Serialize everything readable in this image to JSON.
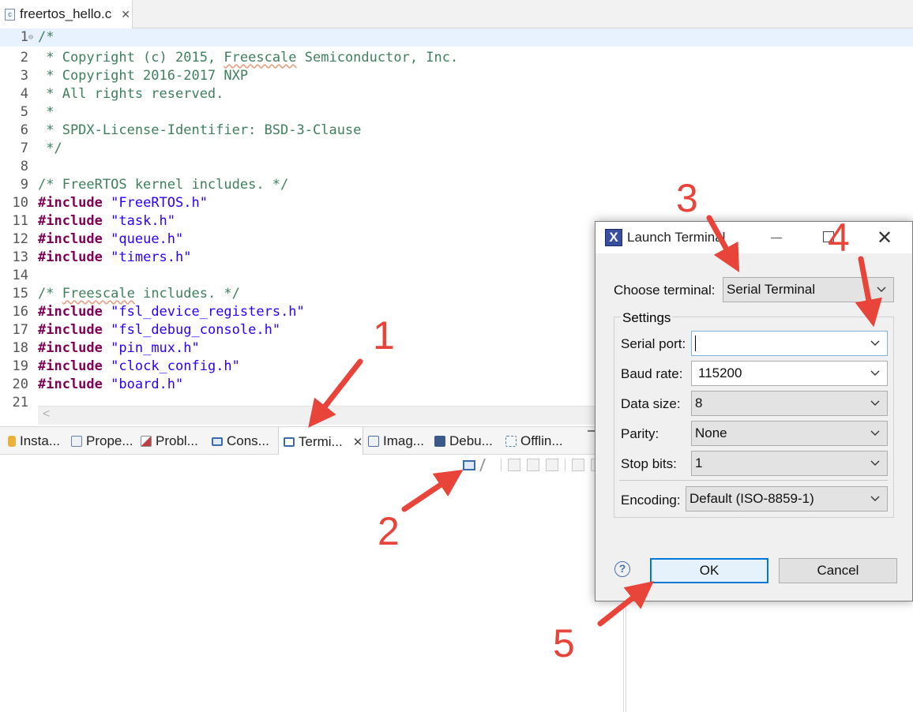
{
  "editor": {
    "tab_label": "freertos_hello.c",
    "close_symbol": "✕",
    "scroll_left_symbol": "<",
    "lines": [
      {
        "no": "1",
        "segments": [
          {
            "t": "/*",
            "c": "comment"
          }
        ]
      },
      {
        "no": "2",
        "segments": [
          {
            "t": " * Copyright (c) 2015, ",
            "c": "comment"
          },
          {
            "t": "Freescale",
            "c": "comment-sq"
          },
          {
            "t": " Semiconductor, Inc.",
            "c": "comment"
          }
        ]
      },
      {
        "no": "3",
        "segments": [
          {
            "t": " * Copyright 2016-2017 NXP",
            "c": "comment"
          }
        ]
      },
      {
        "no": "4",
        "segments": [
          {
            "t": " * All rights reserved.",
            "c": "comment"
          }
        ]
      },
      {
        "no": "5",
        "segments": [
          {
            "t": " *",
            "c": "comment"
          }
        ]
      },
      {
        "no": "6",
        "segments": [
          {
            "t": " * SPDX-License-Identifier: BSD-3-Clause",
            "c": "comment"
          }
        ]
      },
      {
        "no": "7",
        "segments": [
          {
            "t": " */",
            "c": "comment"
          }
        ]
      },
      {
        "no": "8",
        "segments": []
      },
      {
        "no": "9",
        "segments": [
          {
            "t": "/* FreeRTOS kernel includes. */",
            "c": "comment"
          }
        ]
      },
      {
        "no": "10",
        "segments": [
          {
            "t": "#include",
            "c": "kw"
          },
          {
            "t": " ",
            "c": ""
          },
          {
            "t": "\"FreeRTOS.h\"",
            "c": "str"
          }
        ]
      },
      {
        "no": "11",
        "segments": [
          {
            "t": "#include",
            "c": "kw"
          },
          {
            "t": " ",
            "c": ""
          },
          {
            "t": "\"task.h\"",
            "c": "str"
          }
        ]
      },
      {
        "no": "12",
        "segments": [
          {
            "t": "#include",
            "c": "kw"
          },
          {
            "t": " ",
            "c": ""
          },
          {
            "t": "\"queue.h\"",
            "c": "str"
          }
        ]
      },
      {
        "no": "13",
        "segments": [
          {
            "t": "#include",
            "c": "kw"
          },
          {
            "t": " ",
            "c": ""
          },
          {
            "t": "\"timers.h\"",
            "c": "str"
          }
        ]
      },
      {
        "no": "14",
        "segments": []
      },
      {
        "no": "15",
        "segments": [
          {
            "t": "/* ",
            "c": "comment"
          },
          {
            "t": "Freescale",
            "c": "comment-sq"
          },
          {
            "t": " includes. */",
            "c": "comment"
          }
        ]
      },
      {
        "no": "16",
        "segments": [
          {
            "t": "#include",
            "c": "kw"
          },
          {
            "t": " ",
            "c": ""
          },
          {
            "t": "\"fsl_device_registers.h\"",
            "c": "str"
          }
        ]
      },
      {
        "no": "17",
        "segments": [
          {
            "t": "#include",
            "c": "kw"
          },
          {
            "t": " ",
            "c": ""
          },
          {
            "t": "\"fsl_debug_console.h\"",
            "c": "str"
          }
        ]
      },
      {
        "no": "18",
        "segments": [
          {
            "t": "#include",
            "c": "kw"
          },
          {
            "t": " ",
            "c": ""
          },
          {
            "t": "\"pin_mux.h\"",
            "c": "str"
          }
        ]
      },
      {
        "no": "19",
        "segments": [
          {
            "t": "#include",
            "c": "kw"
          },
          {
            "t": " ",
            "c": ""
          },
          {
            "t": "\"clock_config.h\"",
            "c": "str"
          }
        ]
      },
      {
        "no": "20",
        "segments": [
          {
            "t": "#include",
            "c": "kw"
          },
          {
            "t": " ",
            "c": ""
          },
          {
            "t": "\"board.h\"",
            "c": "str"
          }
        ]
      },
      {
        "no": "21",
        "segments": []
      }
    ]
  },
  "views": {
    "tabs": [
      {
        "label": "Insta...",
        "icon": "cylinder-icon",
        "color": "#e8b33a"
      },
      {
        "label": "Prope...",
        "icon": "properties-icon",
        "color": "#6a7fa8"
      },
      {
        "label": "Probl...",
        "icon": "problems-icon",
        "color": "#c04040"
      },
      {
        "label": "Cons...",
        "icon": "console-icon",
        "color": "#3a6ab0"
      },
      {
        "label": "Termi...",
        "icon": "terminal-icon",
        "color": "#3a6ab0",
        "active": true
      },
      {
        "label": "Imag...",
        "icon": "image-info-icon",
        "color": "#4a6fa5"
      },
      {
        "label": "Debu...",
        "icon": "debugger-icon",
        "color": "#3a5a8a"
      },
      {
        "label": "Offlin...",
        "icon": "offline-icon",
        "color": "#5a7a9a"
      }
    ],
    "close_symbol": "✕"
  },
  "dialog": {
    "title": "Launch Terminal",
    "close_symbol": "✕",
    "choose_terminal_label": "Choose terminal:",
    "choose_terminal_value": "Serial Terminal",
    "settings_legend": "Settings",
    "fields": [
      {
        "label": "Serial port:",
        "value": ""
      },
      {
        "label": "Baud rate:",
        "value": "115200"
      },
      {
        "label": "Data size:",
        "value": "8"
      },
      {
        "label": "Parity:",
        "value": "None"
      },
      {
        "label": "Stop bits:",
        "value": "1"
      }
    ],
    "encoding_label": "Encoding:",
    "encoding_value": "Default (ISO-8859-1)",
    "help_symbol": "?",
    "ok_label": "OK",
    "cancel_label": "Cancel",
    "accent_color": "#0078d7"
  },
  "annotations": {
    "color": "#e8443a",
    "steps": [
      "1",
      "2",
      "3",
      "4",
      "5"
    ]
  }
}
